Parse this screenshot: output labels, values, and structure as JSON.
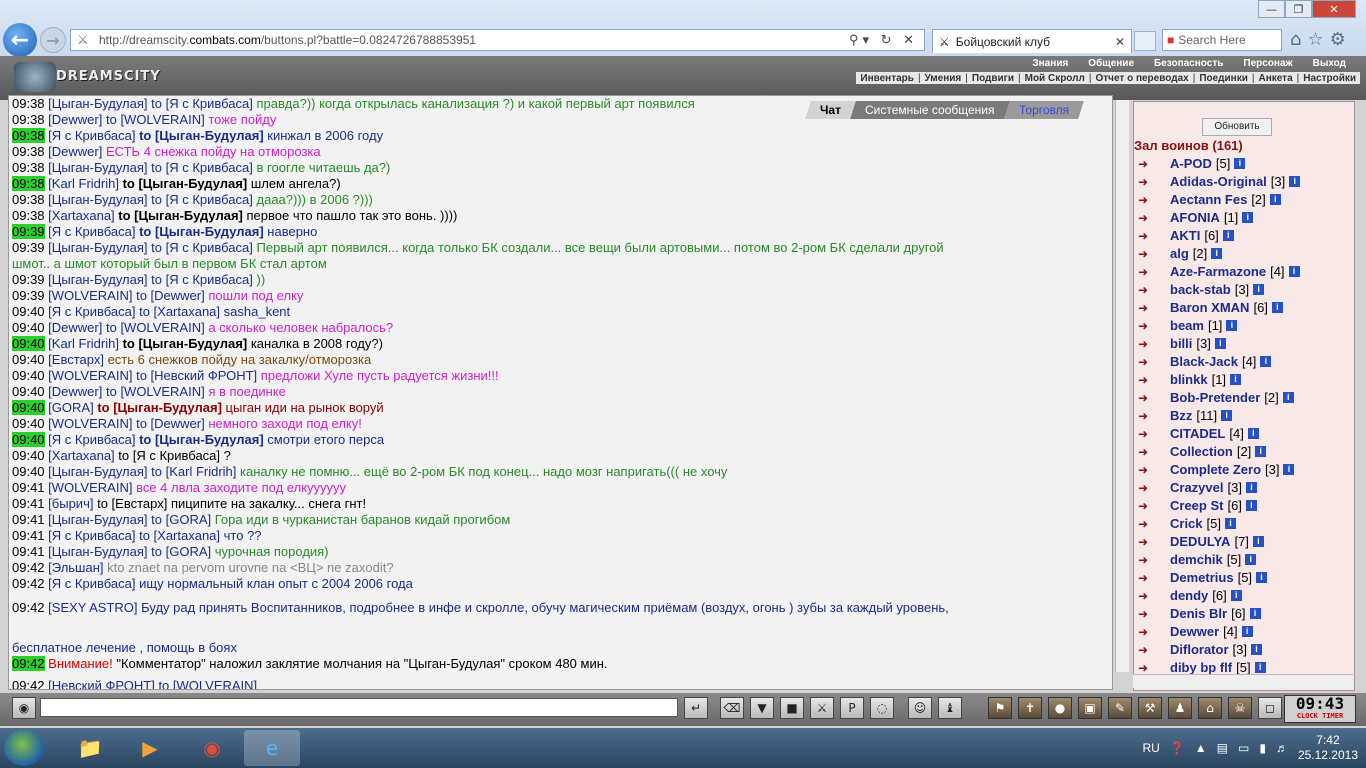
{
  "browser": {
    "url_prefix": "http://dreamscity.",
    "url_host": "combats.com",
    "url_rest": "/buttons.pl?battle=0.0824726788853951",
    "tab_title": "Бойцовский клуб",
    "search_placeholder": "Search Here"
  },
  "game": {
    "logo": "DREAMSCITY",
    "menu_top": [
      "Знания",
      "Общение",
      "Безопасность",
      "Персонаж",
      "Выход"
    ],
    "menu_sub": [
      "Инвентарь",
      "Умения",
      "Подвиги",
      "Мой Скролл",
      "Отчет о переводах",
      "Поединки",
      "Анкета",
      "Настройки"
    ],
    "chat_tabs": [
      "Чат",
      "Системные сообщения",
      "Торговля"
    ]
  },
  "chat": {
    "lines": [
      {
        "time": "09:38",
        "hl": false,
        "user": "Цыган-Будулая",
        "to": "to [Я с Кривбаса]",
        "text": "правда?)) когда открылась канализация ?) и какой первый арт появился",
        "cls": "msgg"
      },
      {
        "time": "09:38",
        "hl": false,
        "user": "Dewwer",
        "to": "to [WOLVERAIN]",
        "text": "тоже пойду",
        "cls": "msgp"
      },
      {
        "time": "09:38",
        "hl": true,
        "user": "Я с Кривбаса",
        "to": "to [Цыган-Будулая]",
        "text": "кинжал в 2006 году",
        "cls": "msgb",
        "bold": true
      },
      {
        "time": "09:38",
        "hl": false,
        "user": "Dewwer",
        "to": "",
        "text": "ЕСТЬ 4 снежка пойду на отморозка",
        "cls": "msgp"
      },
      {
        "time": "09:38",
        "hl": false,
        "user": "Цыган-Будулая",
        "to": "to [Я с Кривбаса]",
        "text": "в гоогле читаешь да?)",
        "cls": "msgg"
      },
      {
        "time": "09:38",
        "hl": true,
        "user": "Karl Fridrih",
        "to": "to [Цыган-Будулая]",
        "text": "шлем ангела?)",
        "cls": "msgk",
        "bold": true
      },
      {
        "time": "09:38",
        "hl": false,
        "user": "Цыган-Будулая",
        "to": "to [Я с Кривбаса]",
        "text": "дааа?))) в 2006 ?)))",
        "cls": "msgg"
      },
      {
        "time": "09:38",
        "hl": false,
        "user": "Xartaxana",
        "to": "to [Цыган-Будулая]",
        "text": "первое что пашло так это вонь. ))))",
        "cls": "msgk",
        "bold": true
      },
      {
        "time": "09:39",
        "hl": true,
        "user": "Я с Кривбаса",
        "to": "to [Цыган-Будулая]",
        "text": "наверно",
        "cls": "msgb",
        "bold": true
      },
      {
        "time": "09:39",
        "hl": false,
        "user": "Цыган-Будулая",
        "to": "to [Я с Кривбаса]",
        "text": "Первый арт появился... когда только БК создали... все вещи были артовыми... потом во 2-ром БК сделали другой",
        "cls": "msgg"
      },
      {
        "time": "",
        "hl": false,
        "user": "",
        "to": "",
        "text": "шмот.. а шмот который был в первом БК стал артом",
        "cls": "msgg"
      },
      {
        "time": "09:39",
        "hl": false,
        "user": "Цыган-Будулая",
        "to": "to [Я с Кривбаса]",
        "text": "))",
        "cls": "msgg"
      },
      {
        "time": "09:39",
        "hl": false,
        "user": "WOLVERAIN",
        "to": "to [Dewwer]",
        "text": "пошли под елку",
        "cls": "msgp"
      },
      {
        "time": "09:40",
        "hl": false,
        "user": "Я с Кривбаса",
        "to": "to [Xartaxana]",
        "text": "sasha_kent",
        "cls": "msgb"
      },
      {
        "time": "09:40",
        "hl": false,
        "user": "Dewwer",
        "to": "to [WOLVERAIN]",
        "text": "а сколько человек набралось?",
        "cls": "msgp"
      },
      {
        "time": "09:40",
        "hl": true,
        "user": "Karl Fridrih",
        "to": "to [Цыган-Будулая]",
        "text": "каналка в 2008 году?)",
        "cls": "msgk",
        "bold": true
      },
      {
        "time": "09:40",
        "hl": false,
        "user": "Евстарх",
        "to": "",
        "text": "есть 6 снежков пойду на закалку/отморозка",
        "cls": "msgbr"
      },
      {
        "time": "09:40",
        "hl": false,
        "user": "WOLVERAIN",
        "to": "to [Невский ФРОНТ]",
        "text": "предложи Хуле пусть радуется жизни!!!",
        "cls": "msgp"
      },
      {
        "time": "09:40",
        "hl": false,
        "user": "Dewwer",
        "to": "to [WOLVERAIN]",
        "text": "я в поединке",
        "cls": "msgp"
      },
      {
        "time": "09:40",
        "hl": true,
        "user": "GORA",
        "to": "to [Цыган-Будулая]",
        "text": "цыган иди на рынок воруй",
        "cls": "msgdr",
        "bold": true
      },
      {
        "time": "09:40",
        "hl": false,
        "user": "WOLVERAIN",
        "to": "to [Dewwer]",
        "text": "немного заходи под елку!",
        "cls": "msgp"
      },
      {
        "time": "09:40",
        "hl": true,
        "user": "Я с Кривбаса",
        "to": "to [Цыган-Будулая]",
        "text": "смотри етого перса",
        "cls": "msgb",
        "bold": true
      },
      {
        "time": "09:40",
        "hl": false,
        "user": "Xartaxana",
        "to": "to [Я с Кривбаса]",
        "text": "?",
        "cls": "msgk"
      },
      {
        "time": "09:40",
        "hl": false,
        "user": "Цыган-Будулая",
        "to": "to [Karl Fridrih]",
        "text": "каналку не помню... ещё во 2-ром БК под конец... надо мозг напригать((( не хочу",
        "cls": "msgg"
      },
      {
        "time": "09:41",
        "hl": false,
        "user": "WOLVERAIN",
        "to": "",
        "text": "все 4 лвла заходите под елкуууууу",
        "cls": "msgp"
      },
      {
        "time": "09:41",
        "hl": false,
        "user": "бырич",
        "to": "to [Евстарх]",
        "text": "пиципите на закалку... снега гнт!",
        "cls": "msgk"
      },
      {
        "time": "09:41",
        "hl": false,
        "user": "Цыган-Будулая",
        "to": "to [GORA]",
        "text": "Гора иди в чурканистан баранов кидай прогибом",
        "cls": "msgg"
      },
      {
        "time": "09:41",
        "hl": false,
        "user": "Я с Кривбаса",
        "to": "to [Xartaxana]",
        "text": "что ??",
        "cls": "msgb"
      },
      {
        "time": "09:41",
        "hl": false,
        "user": "Цыган-Будулая",
        "to": "to [GORA]",
        "text": "чурочная породия)",
        "cls": "msgg"
      },
      {
        "time": "09:42",
        "hl": false,
        "user": "Эльшан",
        "to": "",
        "text": "kto znaet na pervom urovne na <ВЦ> ne zaxodit?",
        "cls": "dim"
      },
      {
        "time": "09:42",
        "hl": false,
        "user": "Я с Кривбаса",
        "to": "",
        "text": "ищу нормальный клан опыт с 2004 2006 года",
        "cls": "msgb"
      },
      {
        "time": "09:42",
        "hl": false,
        "user": "SEXY ASTRO",
        "to": "",
        "text": "Буду рад принять Воспитанников, подробнее в инфе и скролле, обучу магическим приёмам (воздух, огонь        ) зубы за каждый уровень,",
        "cls": "msgb"
      },
      {
        "time": "",
        "hl": false,
        "user": "",
        "to": "",
        "text": "бесплатное лечение        , помощь в боях",
        "cls": "msgb"
      },
      {
        "time": "09:42",
        "hl": true,
        "user": "",
        "to": "",
        "warn": "Внимание!",
        "text": " \"Комментатор\" наложил заклятие молчания на \"Цыган-Будулая\" сроком 480 мин.",
        "cls": "msgk"
      },
      {
        "time": "09:42",
        "hl": false,
        "user": "Невский ФРОНТ",
        "to": "to [WOLVERAIN]",
        "text": "",
        "cls": "msgb"
      }
    ]
  },
  "sidebar": {
    "refresh": "Обновить",
    "hall": "Зал воинов (161)",
    "players": [
      {
        "name": "A-POD",
        "lvl": "[5]"
      },
      {
        "name": "Adidas-Original",
        "lvl": "[3]"
      },
      {
        "name": "Aectann Fes",
        "lvl": "[2]"
      },
      {
        "name": "AFONIA",
        "lvl": "[1]"
      },
      {
        "name": "AKTI",
        "lvl": "[6]"
      },
      {
        "name": "alg",
        "lvl": "[2]"
      },
      {
        "name": "Aze-Farmazone",
        "lvl": "[4]"
      },
      {
        "name": "back-stab",
        "lvl": "[3]"
      },
      {
        "name": "Baron XMAN",
        "lvl": "[6]"
      },
      {
        "name": "beam",
        "lvl": "[1]"
      },
      {
        "name": "billi",
        "lvl": "[3]"
      },
      {
        "name": "Black-Jack",
        "lvl": "[4]"
      },
      {
        "name": "blinkk",
        "lvl": "[1]"
      },
      {
        "name": "Bob-Pretender",
        "lvl": "[2]"
      },
      {
        "name": "Bzz",
        "lvl": "[11]"
      },
      {
        "name": "CITADEL",
        "lvl": "[4]"
      },
      {
        "name": "Collection",
        "lvl": "[2]"
      },
      {
        "name": "Complete Zero",
        "lvl": "[3]"
      },
      {
        "name": "Crazyvel",
        "lvl": "[3]"
      },
      {
        "name": "Creep St",
        "lvl": "[6]"
      },
      {
        "name": "Crick",
        "lvl": "[5]"
      },
      {
        "name": "DEDULYA",
        "lvl": "[7]"
      },
      {
        "name": "demchik",
        "lvl": "[5]"
      },
      {
        "name": "Demetrius",
        "lvl": "[5]"
      },
      {
        "name": "dendy",
        "lvl": "[6]"
      },
      {
        "name": "Denis Blr",
        "lvl": "[6]"
      },
      {
        "name": "Dewwer",
        "lvl": "[4]"
      },
      {
        "name": "Diflorator",
        "lvl": "[3]"
      },
      {
        "name": "diby bp flf",
        "lvl": "[5]"
      }
    ]
  },
  "bottombar": {
    "clock": "09:43",
    "clock_label1": "CLOCK",
    "clock_label2": "TIMER"
  },
  "taskbar": {
    "lang": "RU",
    "time": "7:42",
    "date": "25.12.2013"
  }
}
